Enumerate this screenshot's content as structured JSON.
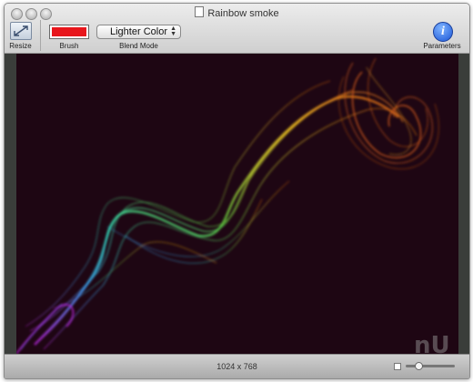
{
  "window": {
    "title": "Rainbow smoke"
  },
  "toolbar": {
    "resize_label": "Resize",
    "brush_label": "Brush",
    "brush_color": "#e8161c",
    "blend_mode_value": "Lighter Color",
    "blend_mode_label": "Blend Mode",
    "parameters_label": "Parameters"
  },
  "canvas": {
    "background": "#1e0613",
    "smoke_colors": [
      "#b020d0",
      "#3aa0f0",
      "#33e0c0",
      "#60d040",
      "#c8d830",
      "#f0c020",
      "#e06018"
    ]
  },
  "statusbar": {
    "dimensions": "1024 x 768",
    "zoom_fraction": 0.25
  }
}
